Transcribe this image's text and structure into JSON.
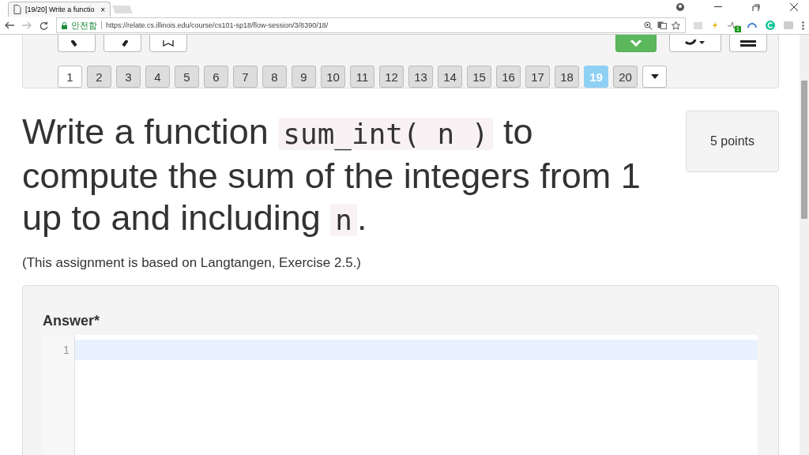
{
  "browser": {
    "tab_title": "[19/20] Write a functio",
    "tab_close": "×",
    "secure_label": "안전함",
    "url": "https://relate.cs.illinois.edu/course/cs101-sp18/flow-session/3/8390/18/",
    "extension_badge": "1"
  },
  "pages": [
    {
      "label": "1",
      "selected": false,
      "visited": false
    },
    {
      "label": "2",
      "selected": false,
      "visited": true
    },
    {
      "label": "3",
      "selected": false,
      "visited": true
    },
    {
      "label": "4",
      "selected": false,
      "visited": true
    },
    {
      "label": "5",
      "selected": false,
      "visited": true
    },
    {
      "label": "6",
      "selected": false,
      "visited": true
    },
    {
      "label": "7",
      "selected": false,
      "visited": true
    },
    {
      "label": "8",
      "selected": false,
      "visited": true
    },
    {
      "label": "9",
      "selected": false,
      "visited": true
    },
    {
      "label": "10",
      "selected": false,
      "visited": true
    },
    {
      "label": "11",
      "selected": false,
      "visited": true
    },
    {
      "label": "12",
      "selected": false,
      "visited": true
    },
    {
      "label": "13",
      "selected": false,
      "visited": true
    },
    {
      "label": "14",
      "selected": false,
      "visited": true
    },
    {
      "label": "15",
      "selected": false,
      "visited": true
    },
    {
      "label": "16",
      "selected": false,
      "visited": true
    },
    {
      "label": "17",
      "selected": false,
      "visited": true
    },
    {
      "label": "18",
      "selected": false,
      "visited": true
    },
    {
      "label": "19",
      "selected": true,
      "visited": true
    },
    {
      "label": "20",
      "selected": false,
      "visited": true
    }
  ],
  "question": {
    "title_parts": [
      {
        "kind": "text",
        "text": "Write a function "
      },
      {
        "kind": "code",
        "text": "sum_int( n )"
      },
      {
        "kind": "text",
        "text": " to compute the sum of the integers from 1 up to and including "
      },
      {
        "kind": "code",
        "text": "n"
      },
      {
        "kind": "text",
        "text": "."
      }
    ],
    "points": "5 points",
    "note": "(This assignment is based on Langtangen, Exercise 2.5.)"
  },
  "answer": {
    "label": "Answer*",
    "line_numbers": [
      "1"
    ]
  }
}
